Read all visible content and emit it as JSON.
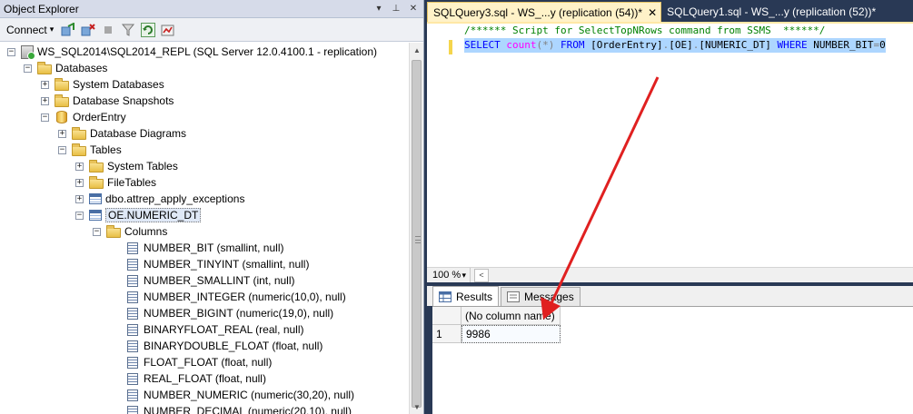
{
  "object_explorer": {
    "title": "Object Explorer",
    "pin_glyph": "▾",
    "autohide_glyph": "⊥",
    "close_glyph": "✕",
    "connect_label": "Connect",
    "connect_arrow": "▾",
    "tree": [
      {
        "label": "WS_SQL2014\\SQL2014_REPL (SQL Server 12.0.4100.1 - replication)",
        "expander": "−",
        "icon": "server-icon"
      },
      {
        "label": "Databases",
        "expander": "−",
        "icon": "folder-icon"
      },
      {
        "label": "System Databases",
        "expander": "+",
        "icon": "folder-icon"
      },
      {
        "label": "Database Snapshots",
        "expander": "+",
        "icon": "folder-icon"
      },
      {
        "label": "OrderEntry",
        "expander": "−",
        "icon": "database-icon"
      },
      {
        "label": "Database Diagrams",
        "expander": "+",
        "icon": "folder-icon"
      },
      {
        "label": "Tables",
        "expander": "−",
        "icon": "folder-icon"
      },
      {
        "label": "System Tables",
        "expander": "+",
        "icon": "folder-icon"
      },
      {
        "label": "FileTables",
        "expander": "+",
        "icon": "folder-icon"
      },
      {
        "label": "dbo.attrep_apply_exceptions",
        "expander": "+",
        "icon": "table-icon"
      },
      {
        "label": "OE.NUMERIC_DT",
        "expander": "−",
        "icon": "table-icon",
        "selected": true
      },
      {
        "label": "Columns",
        "expander": "−",
        "icon": "folder-icon"
      },
      {
        "label": "NUMBER_BIT (smallint, null)",
        "icon": "column-icon"
      },
      {
        "label": "NUMBER_TINYINT (smallint, null)",
        "icon": "column-icon"
      },
      {
        "label": "NUMBER_SMALLINT (int, null)",
        "icon": "column-icon"
      },
      {
        "label": "NUMBER_INTEGER (numeric(10,0), null)",
        "icon": "column-icon"
      },
      {
        "label": "NUMBER_BIGINT (numeric(19,0), null)",
        "icon": "column-icon"
      },
      {
        "label": "BINARYFLOAT_REAL (real, null)",
        "icon": "column-icon"
      },
      {
        "label": "BINARYDOUBLE_FLOAT (float, null)",
        "icon": "column-icon"
      },
      {
        "label": "FLOAT_FLOAT (float, null)",
        "icon": "column-icon"
      },
      {
        "label": "REAL_FLOAT (float, null)",
        "icon": "column-icon"
      },
      {
        "label": "NUMBER_NUMERIC (numeric(30,20), null)",
        "icon": "column-icon"
      },
      {
        "label": "NUMBER_DECIMAL (numeric(20,10), null)",
        "icon": "column-icon"
      }
    ]
  },
  "tabs": [
    {
      "label": "SQLQuery3.sql - WS_...y (replication (54))*",
      "active": true,
      "close": "✕"
    },
    {
      "label": "SQLQuery1.sql - WS_...y (replication (52))*",
      "active": false
    }
  ],
  "editor": {
    "comment": "/****** Script for SelectTopNRows command from SSMS  ******/",
    "select_kw": "SELECT",
    "count_fn": "count",
    "open_paren": "(",
    "star": "*",
    "close_paren": ")",
    "from_kw": "FROM",
    "db_part": "[OrderEntry]",
    "dot1": ".",
    "schema_part": "[OE]",
    "dot2": ".",
    "table_part": "[NUMERIC_DT]",
    "where_kw": "WHERE",
    "condition_col": "NUMBER_BIT",
    "condition_op": "=",
    "condition_val": "0"
  },
  "status_bar": {
    "zoom": "100 %",
    "zoom_arrow": "▾",
    "scroll_left": "<"
  },
  "results": {
    "tabs": [
      "Results",
      "Messages"
    ],
    "columns": [
      "(No column name)"
    ],
    "rows": [
      {
        "row_number": "1",
        "cells": [
          "9986"
        ]
      }
    ]
  },
  "colors": {
    "annotation_arrow": "#e02020",
    "chrome_background": "#293955",
    "active_tab": "#fff2c8"
  }
}
